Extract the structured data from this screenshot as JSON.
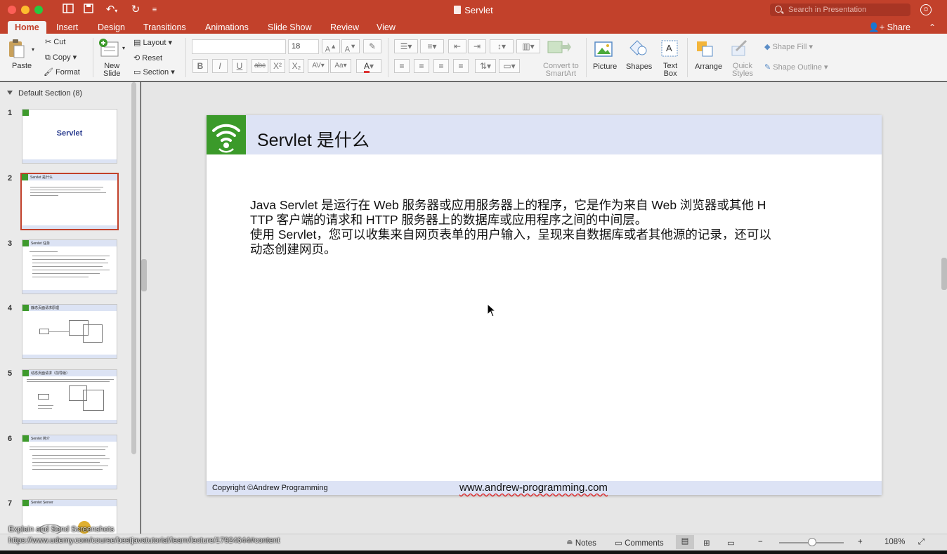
{
  "window": {
    "title": "Servlet",
    "search_placeholder": "Search in Presentation"
  },
  "tabs": [
    {
      "label": "Home",
      "active": true
    },
    {
      "label": "Insert"
    },
    {
      "label": "Design"
    },
    {
      "label": "Transitions"
    },
    {
      "label": "Animations"
    },
    {
      "label": "Slide Show"
    },
    {
      "label": "Review"
    },
    {
      "label": "View"
    }
  ],
  "share_label": "Share",
  "ribbon": {
    "paste": "Paste",
    "cut": "Cut",
    "copy": "Copy",
    "format": "Format",
    "new_slide": [
      "New",
      "Slide"
    ],
    "layout": "Layout",
    "reset": "Reset",
    "section": "Section",
    "font_name": "",
    "font_size": "18",
    "convert_smartart": [
      "Convert to",
      "SmartArt"
    ],
    "picture": "Picture",
    "shapes": "Shapes",
    "text_box": [
      "Text",
      "Box"
    ],
    "arrange": "Arrange",
    "quick_styles": [
      "Quick",
      "Styles"
    ],
    "shape_fill": "Shape Fill",
    "shape_outline": "Shape Outline",
    "format_buttons": [
      "B",
      "I",
      "U",
      "abc",
      "X²",
      "X₂"
    ]
  },
  "thumbnails": {
    "section_label": "Default Section (8)",
    "slides": [
      {
        "num": "1",
        "title": "Servlet"
      },
      {
        "num": "2",
        "title": "Servlet 是什么",
        "selected": true
      },
      {
        "num": "3",
        "title": "Servlet 任务"
      },
      {
        "num": "4",
        "title": "静态页面请求原理"
      },
      {
        "num": "5",
        "title": "动态页面请求（前导版）"
      },
      {
        "num": "6",
        "title": "Servlet 简介"
      },
      {
        "num": "7",
        "title": "Servlet Server"
      }
    ]
  },
  "slide": {
    "title": "Servlet 是什么",
    "body_lines": [
      "Java Servlet 是运行在 Web 服务器或应用服务器上的程序，它是作为来自 Web 浏览器或其他 H",
      "TTP 客户端的请求和 HTTP 服务器上的数据库或应用程序之间的中间层。",
      "使用 Servlet，您可以收集来自网页表单的用户输入，呈现来自数据库或者其他源的记录，还可以",
      "动态创建网页。"
    ],
    "copyright": "Copyright ©Andrew Programming",
    "url": "www.andrew-programming.com",
    "brand_color": "#3b9a2a",
    "header_color": "#dde3f5"
  },
  "statusbar": {
    "notes": "Notes",
    "comments": "Comments",
    "zoom": "108%",
    "zoom_minus": "−",
    "zoom_plus": "+"
  },
  "overlay": {
    "line1": "Explain and Send Screenshots",
    "line2": "https://www.udemy.com/course/bestjavatutorial/learn/lecture/17924644#content"
  },
  "colors": {
    "accent": "#c2412b"
  }
}
